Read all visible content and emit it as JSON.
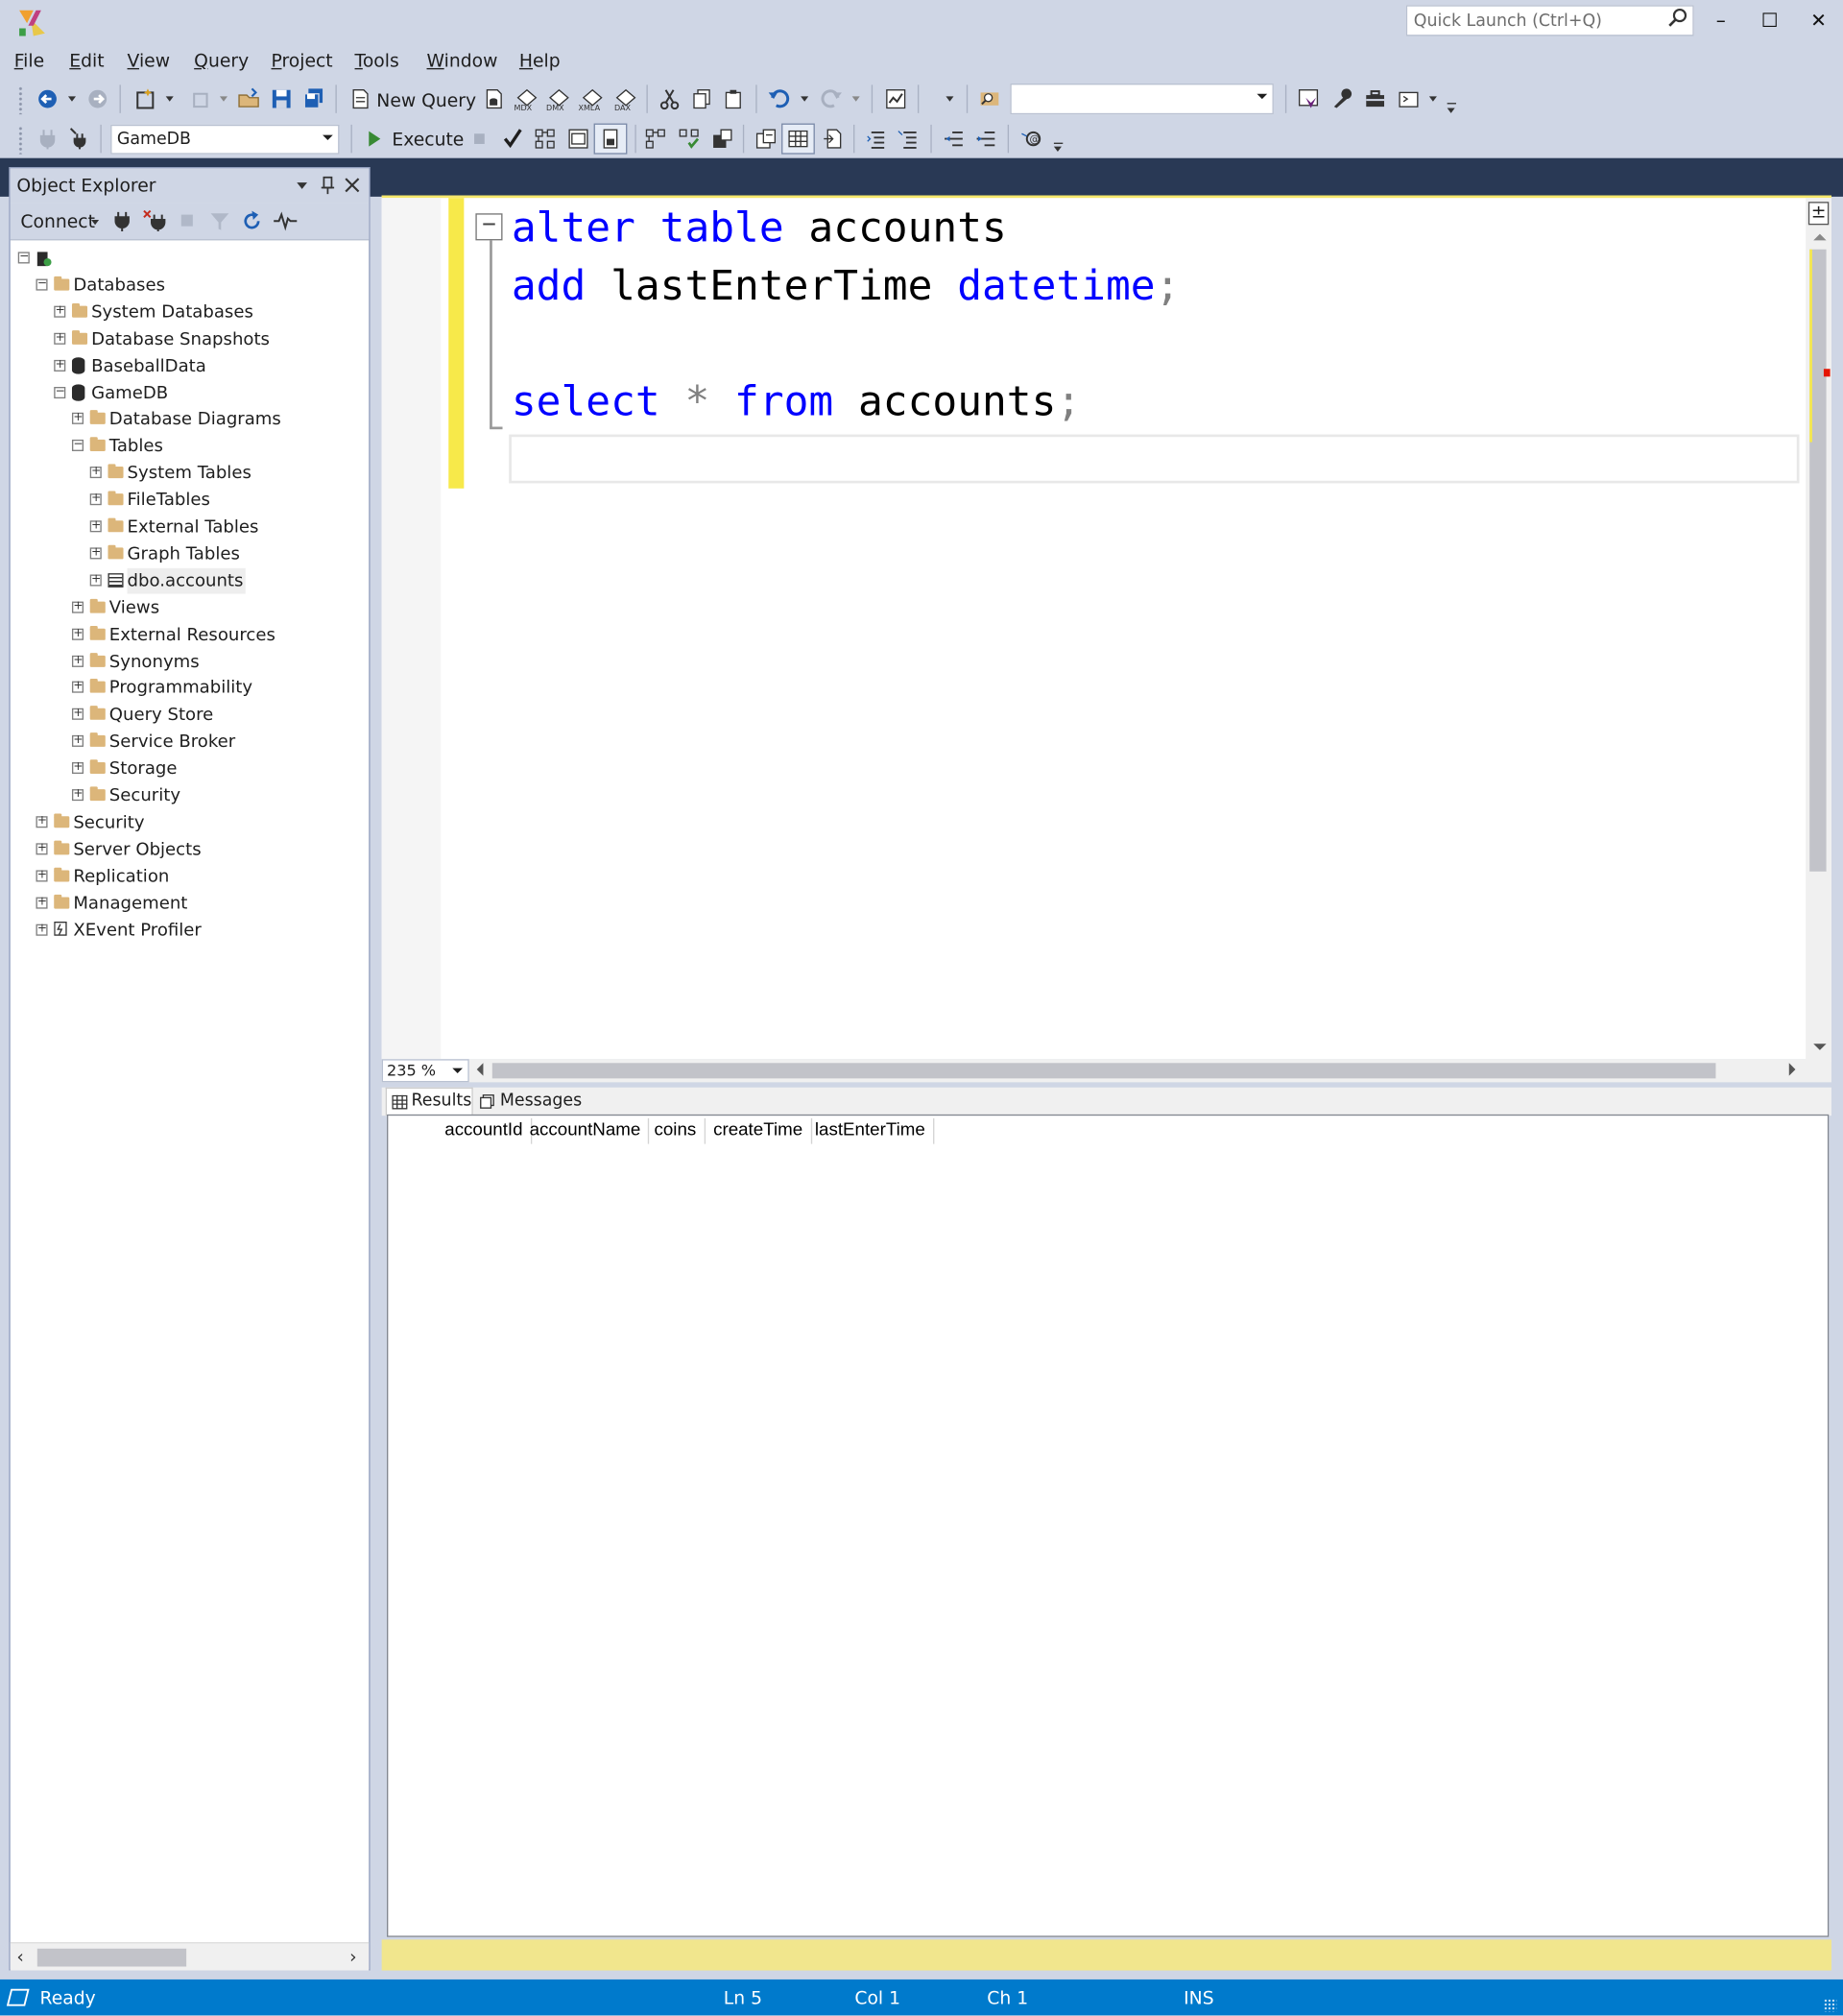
{
  "window": {
    "quick_launch_placeholder": "Quick Launch (Ctrl+Q)",
    "minimize": "–",
    "maximize": "☐",
    "close": "✕"
  },
  "menu": [
    "File",
    "Edit",
    "View",
    "Query",
    "Project",
    "Tools",
    "Window",
    "Help"
  ],
  "toolbar": {
    "new_query": "New Query",
    "database": "GameDB",
    "execute": "Execute",
    "solution_combo": ""
  },
  "object_explorer": {
    "title": "Object Explorer",
    "connect": "Connect",
    "tree": [
      {
        "label": "",
        "level": 0,
        "icon": "server",
        "expanded": true
      },
      {
        "label": "Databases",
        "level": 1,
        "icon": "folder",
        "expanded": true
      },
      {
        "label": "System Databases",
        "level": 2,
        "icon": "folder",
        "expanded": false
      },
      {
        "label": "Database Snapshots",
        "level": 2,
        "icon": "folder",
        "expanded": false
      },
      {
        "label": "BaseballData",
        "level": 2,
        "icon": "database",
        "expanded": false
      },
      {
        "label": "GameDB",
        "level": 2,
        "icon": "database",
        "expanded": true
      },
      {
        "label": "Database Diagrams",
        "level": 3,
        "icon": "folder",
        "expanded": false
      },
      {
        "label": "Tables",
        "level": 3,
        "icon": "folder",
        "expanded": true
      },
      {
        "label": "System Tables",
        "level": 4,
        "icon": "folder",
        "expanded": false
      },
      {
        "label": "FileTables",
        "level": 4,
        "icon": "folder",
        "expanded": false
      },
      {
        "label": "External Tables",
        "level": 4,
        "icon": "folder",
        "expanded": false
      },
      {
        "label": "Graph Tables",
        "level": 4,
        "icon": "folder",
        "expanded": false
      },
      {
        "label": "dbo.accounts",
        "level": 4,
        "icon": "table",
        "expanded": false
      },
      {
        "label": "Views",
        "level": 3,
        "icon": "folder",
        "expanded": false
      },
      {
        "label": "External Resources",
        "level": 3,
        "icon": "folder",
        "expanded": false
      },
      {
        "label": "Synonyms",
        "level": 3,
        "icon": "folder",
        "expanded": false
      },
      {
        "label": "Programmability",
        "level": 3,
        "icon": "folder",
        "expanded": false
      },
      {
        "label": "Query Store",
        "level": 3,
        "icon": "folder",
        "expanded": false
      },
      {
        "label": "Service Broker",
        "level": 3,
        "icon": "folder",
        "expanded": false
      },
      {
        "label": "Storage",
        "level": 3,
        "icon": "folder",
        "expanded": false
      },
      {
        "label": "Security",
        "level": 3,
        "icon": "folder",
        "expanded": false
      },
      {
        "label": "Security",
        "level": 1,
        "icon": "folder",
        "expanded": false
      },
      {
        "label": "Server Objects",
        "level": 1,
        "icon": "folder",
        "expanded": false
      },
      {
        "label": "Replication",
        "level": 1,
        "icon": "folder",
        "expanded": false
      },
      {
        "label": "Management",
        "level": 1,
        "icon": "folder",
        "expanded": false
      },
      {
        "label": "XEvent Profiler",
        "level": 1,
        "icon": "xevent",
        "expanded": false
      }
    ]
  },
  "editor": {
    "lines": [
      [
        {
          "t": "alter",
          "c": "kw"
        },
        {
          "t": " ",
          "c": "id"
        },
        {
          "t": "table",
          "c": "kw"
        },
        {
          "t": " accounts",
          "c": "id"
        }
      ],
      [
        {
          "t": "add",
          "c": "kw"
        },
        {
          "t": " lastEnterTime ",
          "c": "id"
        },
        {
          "t": "datetime",
          "c": "kw"
        },
        {
          "t": ";",
          "c": "op"
        }
      ],
      [],
      [
        {
          "t": "select",
          "c": "kw"
        },
        {
          "t": " ",
          "c": "id"
        },
        {
          "t": "*",
          "c": "op"
        },
        {
          "t": " ",
          "c": "id"
        },
        {
          "t": "from",
          "c": "kw"
        },
        {
          "t": " accounts",
          "c": "id"
        },
        {
          "t": ";",
          "c": "op"
        }
      ],
      []
    ],
    "zoom": "235 %"
  },
  "results": {
    "tab_results": "Results",
    "tab_messages": "Messages",
    "columns": [
      "accountId",
      "accountName",
      "coins",
      "createTime",
      "lastEnterTime"
    ]
  },
  "status": {
    "state": "Ready",
    "ln": "Ln 5",
    "col": "Col 1",
    "ch": "Ch 1",
    "mode": "INS"
  }
}
